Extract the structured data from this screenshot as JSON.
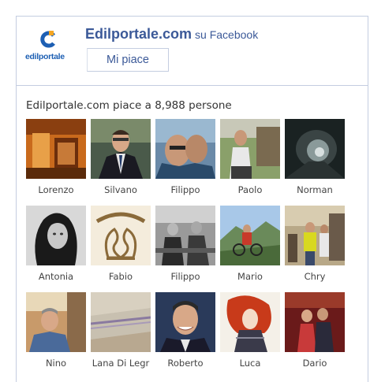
{
  "header": {
    "logo_text": "edilportale",
    "page_name": "Edilportale.com",
    "platform_suffix": "su Facebook",
    "like_button": "Mi piace"
  },
  "fans_summary": "Edilportale.com piace a 8,988 persone",
  "fans": [
    {
      "name": "Lorenzo",
      "photo": "orange-room"
    },
    {
      "name": "Silvano",
      "photo": "man-in-suit"
    },
    {
      "name": "Filippo",
      "photo": "two-men-selfie"
    },
    {
      "name": "Paolo",
      "photo": "man-outdoors"
    },
    {
      "name": "Norman",
      "photo": "tunnel-bw"
    },
    {
      "name": "Antonia",
      "photo": "woman-bw"
    },
    {
      "name": "Fabio",
      "photo": "ville-logo"
    },
    {
      "name": "Filippo",
      "photo": "people-bench-bw"
    },
    {
      "name": "Mario",
      "photo": "cyclist-landscape"
    },
    {
      "name": "Chry",
      "photo": "group-street"
    },
    {
      "name": "Nino",
      "photo": "man-indoors"
    },
    {
      "name": "Lana Di Legr",
      "photo": "wool-texture"
    },
    {
      "name": "Roberto",
      "photo": "smiling-man"
    },
    {
      "name": "Luca",
      "photo": "anime-character"
    },
    {
      "name": "Dario",
      "photo": "couple-red"
    }
  ],
  "colors": {
    "facebook_blue": "#3b5998",
    "border": "#c4cde0",
    "logo_blue": "#1d5fb3",
    "logo_orange": "#f5a623"
  }
}
